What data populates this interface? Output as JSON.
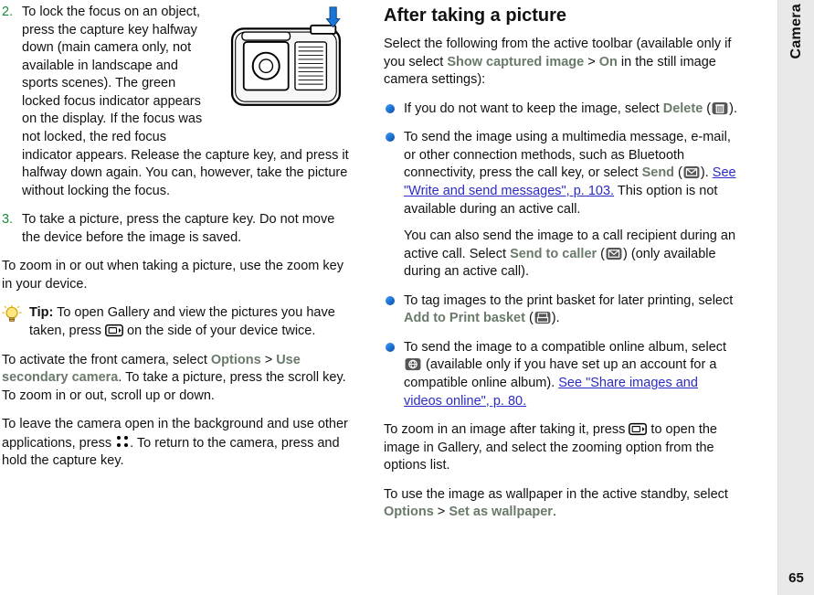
{
  "sidebar": {
    "label": "Camera",
    "pagenum": "65"
  },
  "left": {
    "ol2_num": "2.",
    "ol2_text": "To lock the focus on an object, press the capture key halfway down (main camera only, not available in landscape and sports scenes). The green locked focus indicator appears on the display. If the focus was not locked, the red focus indicator appears. Release the capture key, and press it halfway down again. You can, however, take the picture without locking the focus.",
    "ol3_num": "3.",
    "ol3_text": "To take a picture, press the capture key. Do not move the device before the image is saved.",
    "zoom": "To zoom in or out when taking a picture, use the zoom key in your device.",
    "tip_strong": "Tip:",
    "tip_text_a": " To open Gallery and view the pictures you have taken, press ",
    "tip_text_b": " on the side of your device twice.",
    "front_a": "To activate the front camera, select ",
    "front_opt": "Options",
    "front_gt": " > ",
    "front_use": "Use secondary camera",
    "front_b": ". To take a picture, press the scroll key. To zoom in or out, scroll up or down.",
    "leave_a": "To leave the camera open in the background and use other applications, press ",
    "leave_b": ". To return to the camera, press and hold the capture key."
  },
  "right": {
    "heading": "After taking a picture",
    "intro_a": "Select the following from the active toolbar (available only if you select ",
    "intro_show": "Show captured image",
    "intro_gt": " > ",
    "intro_on": "On",
    "intro_b": " in the still image camera settings):",
    "b1_a": "If you do not want to keep the image, select ",
    "b1_delete": "Delete",
    "b1_b": " (",
    "b1_c": ").",
    "b2_a": "To send the image using a multimedia message, e-mail, or other connection methods, such as Bluetooth connectivity, press the call key, or select ",
    "b2_send": "Send",
    "b2_b": " (",
    "b2_c": "). ",
    "b2_link": "See \"Write and send messages\", p. 103.",
    "b2_d": " This option is not available during an active call.",
    "b2_e": "You can also send the image to a call recipient during an active call. Select ",
    "b2_stc": "Send to caller",
    "b2_f": " (",
    "b2_g": ") (only available during an active call).",
    "b3_a": "To tag images to the print basket for later printing, select ",
    "b3_add": "Add to Print basket",
    "b3_b": " (",
    "b3_c": ").",
    "b4_a": "To send the image to a compatible online album, select ",
    "b4_b": " (available only if you have set up an account for a compatible online album). ",
    "b4_link": "See \"Share images and videos online\", p. 80.",
    "zoom_a": "To zoom in an image after taking it, press ",
    "zoom_b": " to open the image in Gallery, and select the zooming option from the options list.",
    "wall_a": "To use the image as wallpaper in the active standby, select ",
    "wall_opt": "Options",
    "wall_gt": " > ",
    "wall_set": "Set as wallpaper",
    "wall_b": "."
  }
}
